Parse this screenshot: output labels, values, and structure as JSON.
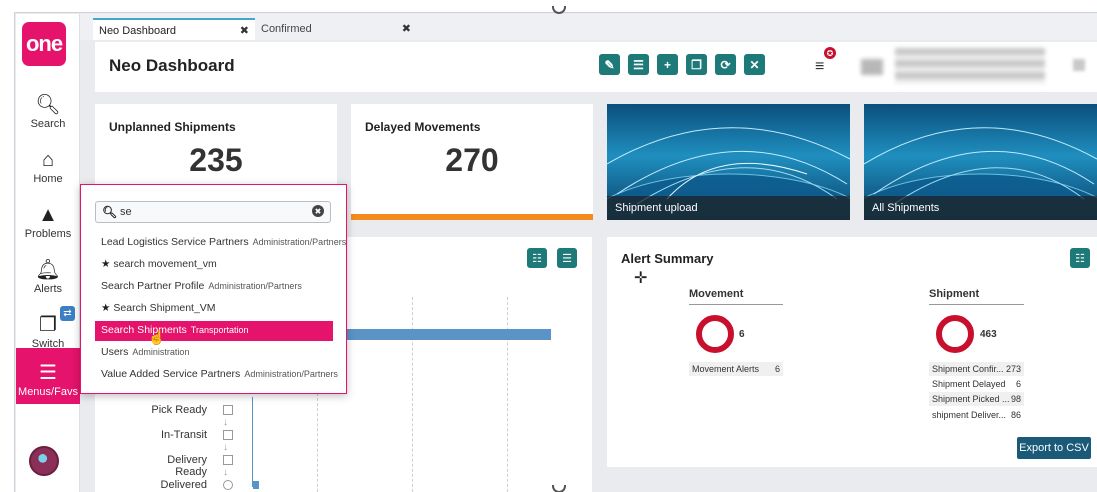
{
  "sidebar": {
    "logo": "one",
    "items": [
      {
        "label": "Search",
        "icon": "search-icon"
      },
      {
        "label": "Home",
        "icon": "home-icon"
      },
      {
        "label": "Problems",
        "icon": "warning-icon"
      },
      {
        "label": "Alerts",
        "icon": "bell-icon"
      },
      {
        "label": "Switch",
        "icon": "switch-icon"
      },
      {
        "label": "Menus/Favs",
        "icon": "hamburger-icon"
      }
    ]
  },
  "tabs": [
    {
      "label": "Neo Dashboard",
      "close": "✖"
    },
    {
      "label": "Confirmed",
      "close": "✖"
    }
  ],
  "header": {
    "title": "Neo Dashboard",
    "menu_glyph": "≡",
    "notif_glyph": "✪",
    "tools": [
      {
        "glyph": "✎",
        "icon": "edit-icon"
      },
      {
        "glyph": "☰",
        "icon": "list-icon"
      },
      {
        "glyph": "+",
        "icon": "add-icon"
      },
      {
        "glyph": "❐",
        "icon": "copy-icon"
      },
      {
        "glyph": "⟳",
        "icon": "refresh-icon"
      },
      {
        "glyph": "✕",
        "icon": "close-icon"
      }
    ]
  },
  "tiles": {
    "unplanned": {
      "title": "Unplanned Shipments",
      "value": "235"
    },
    "delayed": {
      "title": "Delayed Movements",
      "value": "270"
    },
    "upload": {
      "caption": "Shipment upload"
    },
    "all": {
      "caption": "All Shipments"
    }
  },
  "chart_panel": {
    "stages": [
      "Pick Ready",
      "In-Transit",
      "Delivery Ready",
      "Delivered"
    ]
  },
  "alert_summary": {
    "title": "Alert Summary",
    "movement": {
      "heading": "Movement",
      "total": "6",
      "rows": [
        {
          "label": "Movement Alerts",
          "value": "6"
        }
      ]
    },
    "shipment": {
      "heading": "Shipment",
      "total": "463",
      "rows": [
        {
          "label": "Shipment Confir...",
          "value": "273"
        },
        {
          "label": "Shipment Delayed",
          "value": "6"
        },
        {
          "label": "Shipment Picked ...",
          "value": "98"
        },
        {
          "label": "shipment Deliver...",
          "value": "86"
        }
      ]
    },
    "export_label": "Export to CSV"
  },
  "search_popup": {
    "query": "se",
    "clear_glyph": "✖",
    "results": [
      {
        "label": "Lead Logistics Service Partners",
        "category": "Administration/Partners",
        "fav": false
      },
      {
        "label": "search movement_vm",
        "category": "",
        "fav": true
      },
      {
        "label": "Search Partner Profile",
        "category": "Administration/Partners",
        "fav": false
      },
      {
        "label": "Search Shipment_VM",
        "category": "",
        "fav": true
      },
      {
        "label": "Search Shipments",
        "category": "Transportation",
        "fav": false,
        "selected": true
      },
      {
        "label": "Users",
        "category": "Administration",
        "fav": false
      },
      {
        "label": "Value Added Service Partners",
        "category": "Administration/Partners",
        "fav": false
      }
    ]
  },
  "colors": {
    "brand": "#e5136b",
    "accent": "#1e7a78",
    "orange": "#f48c1d",
    "alert_red": "#c8102e"
  }
}
